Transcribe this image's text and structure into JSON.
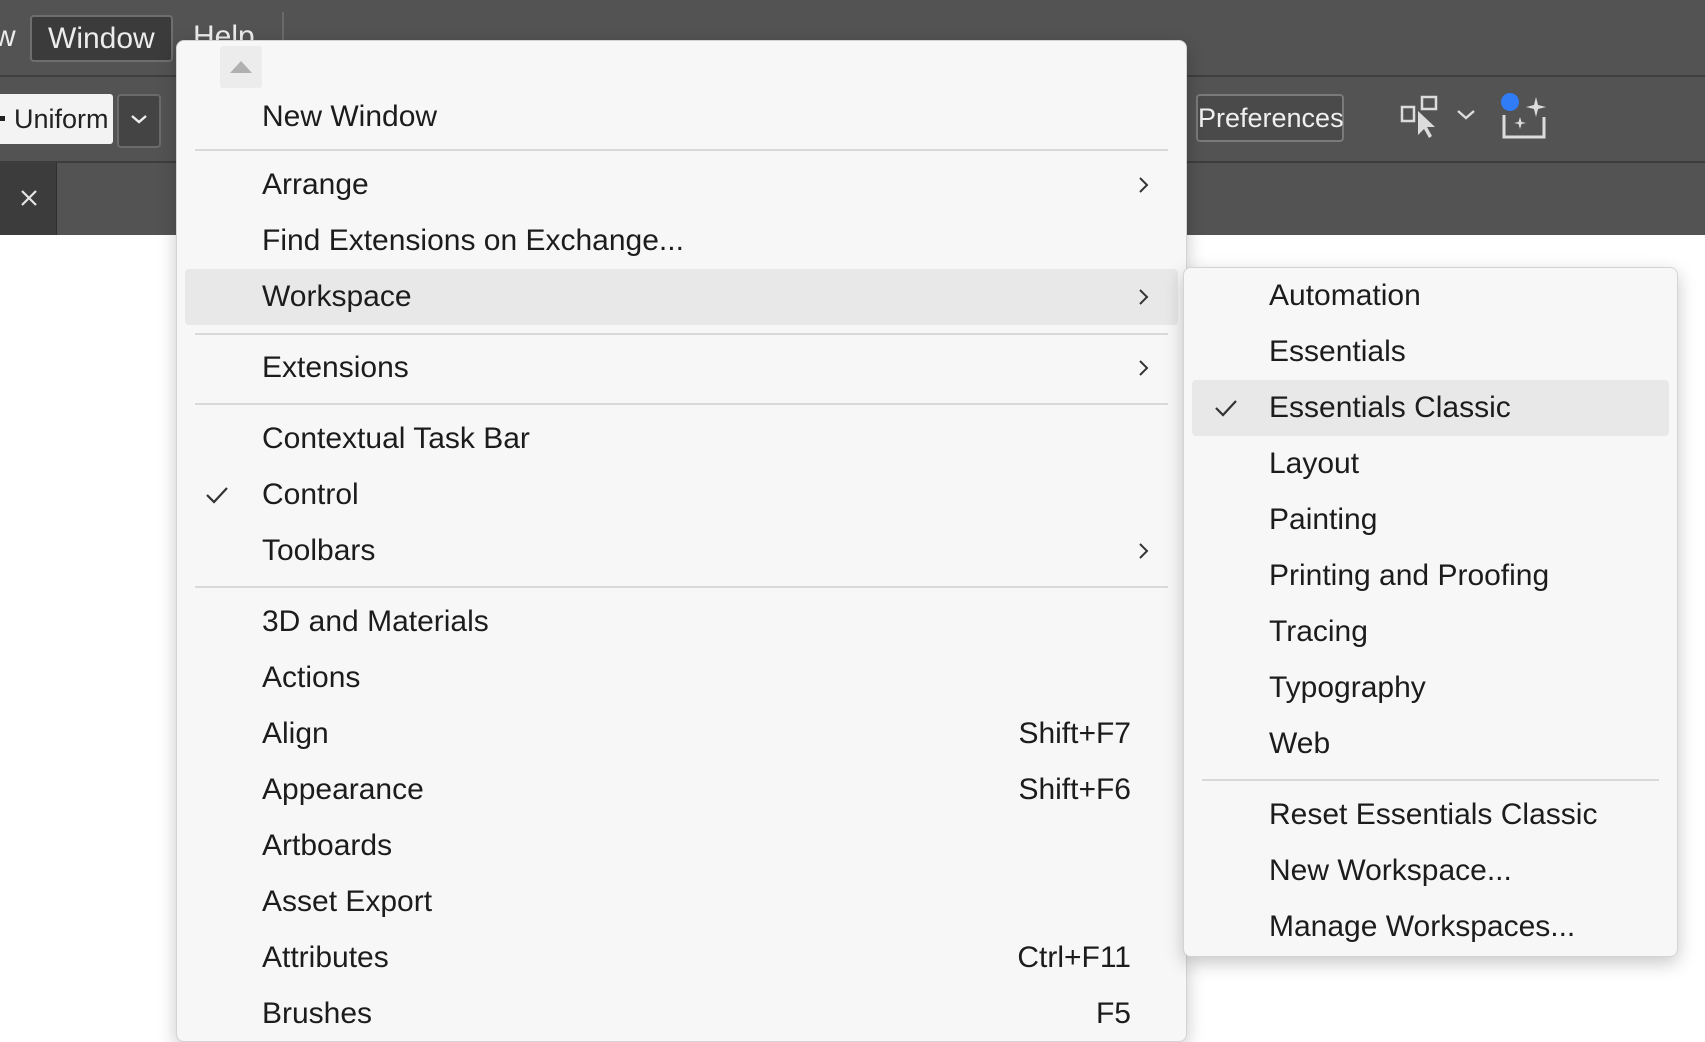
{
  "menubar": {
    "partial_left": "w",
    "window": "Window",
    "help": "Help"
  },
  "control": {
    "stroke_profile": "Uniform",
    "preferences": "Preferences"
  },
  "window_menu": {
    "items": [
      {
        "label": "New Window"
      },
      {
        "label": "Arrange",
        "submenu": true
      },
      {
        "label": "Find Extensions on Exchange..."
      },
      {
        "label": "Workspace",
        "submenu": true,
        "highlighted": true
      },
      {
        "label": "Extensions",
        "submenu": true
      },
      {
        "label": "Contextual Task Bar"
      },
      {
        "label": "Control",
        "checked": true
      },
      {
        "label": "Toolbars",
        "submenu": true
      },
      {
        "label": "3D and Materials"
      },
      {
        "label": "Actions"
      },
      {
        "label": "Align",
        "shortcut": "Shift+F7"
      },
      {
        "label": "Appearance",
        "shortcut": "Shift+F6"
      },
      {
        "label": "Artboards"
      },
      {
        "label": "Asset Export"
      },
      {
        "label": "Attributes",
        "shortcut": "Ctrl+F11"
      },
      {
        "label": "Brushes",
        "shortcut": "F5"
      }
    ]
  },
  "workspace_menu": {
    "items": [
      {
        "label": "Automation"
      },
      {
        "label": "Essentials"
      },
      {
        "label": "Essentials Classic",
        "checked": true,
        "highlighted": true
      },
      {
        "label": "Layout"
      },
      {
        "label": "Painting"
      },
      {
        "label": "Printing and Proofing"
      },
      {
        "label": "Tracing"
      },
      {
        "label": "Typography"
      },
      {
        "label": "Web"
      },
      {
        "label": "Reset Essentials Classic"
      },
      {
        "label": "New Workspace..."
      },
      {
        "label": "Manage Workspaces..."
      }
    ]
  },
  "colors": {
    "chrome": "#535353",
    "menu_bg": "#f7f7f7",
    "highlight": "#e8e8e8",
    "accent_dot": "#2f7cf6"
  },
  "icons": [
    "close-icon",
    "chevron-down-icon",
    "arrange-icon",
    "generative-icon",
    "scroll-up-icon",
    "chevron-right-icon",
    "checkmark-icon"
  ]
}
